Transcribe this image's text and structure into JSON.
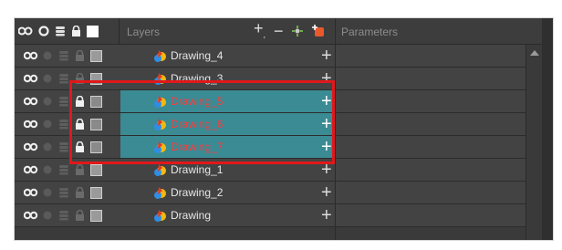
{
  "header": {
    "layers_label": "Layers",
    "parameters_label": "Parameters",
    "tools": [
      {
        "name": "add-layer-icon",
        "glyph": "+"
      },
      {
        "name": "remove-layer-icon",
        "glyph": "−"
      },
      {
        "name": "add-peg-icon",
        "glyph": "✦"
      },
      {
        "name": "add-drawing-layer-icon",
        "glyph": "✚"
      }
    ]
  },
  "layers": [
    {
      "name": "Drawing_4",
      "selected": false
    },
    {
      "name": "Drawing_3",
      "selected": false
    },
    {
      "name": "Drawing_5",
      "selected": true
    },
    {
      "name": "Drawing_6",
      "selected": true
    },
    {
      "name": "Drawing_7",
      "selected": true
    },
    {
      "name": "Drawing_1",
      "selected": false
    },
    {
      "name": "Drawing_2",
      "selected": false
    },
    {
      "name": "Drawing",
      "selected": false
    }
  ],
  "colors": {
    "selected_row": "#3b8b94",
    "selected_text": "#ff3a3a",
    "highlight_box": "#e0181b"
  }
}
